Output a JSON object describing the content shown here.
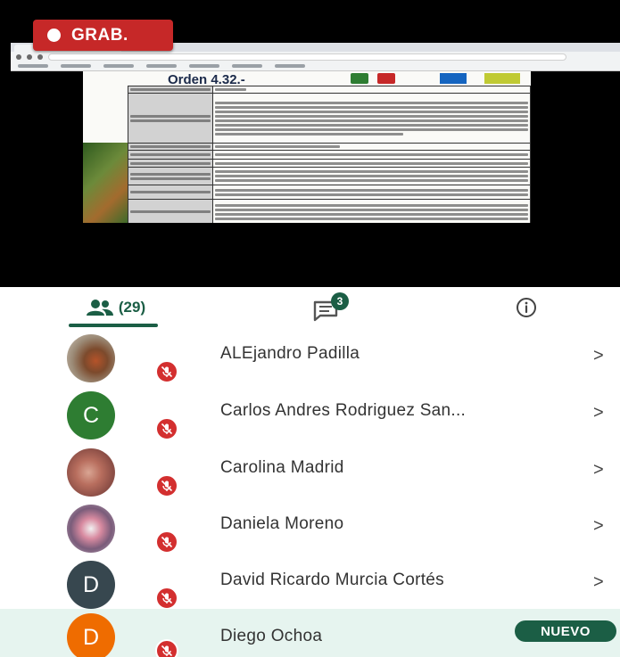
{
  "recording": {
    "label": "GRAB."
  },
  "document": {
    "title": "Orden 4.32.-"
  },
  "tabs": {
    "participants_count": "(29)",
    "chat_unread": "3"
  },
  "participants": [
    {
      "name": "ALEjandro Padilla",
      "initial": "",
      "avatar": "photo",
      "avatar_color": "",
      "muted": true,
      "badge": ""
    },
    {
      "name": "Carlos Andres Rodriguez San...",
      "initial": "C",
      "avatar": "initial",
      "avatar_color": "#2e7d32",
      "muted": true,
      "badge": ""
    },
    {
      "name": "Carolina Madrid",
      "initial": "",
      "avatar": "photo",
      "avatar_color": "",
      "muted": true,
      "badge": ""
    },
    {
      "name": "Daniela Moreno",
      "initial": "",
      "avatar": "photo",
      "avatar_color": "",
      "muted": true,
      "badge": ""
    },
    {
      "name": "David Ricardo Murcia Cortés",
      "initial": "D",
      "avatar": "initial",
      "avatar_color": "#37474f",
      "muted": true,
      "badge": ""
    },
    {
      "name": "Diego Ochoa",
      "initial": "D",
      "avatar": "initial",
      "avatar_color": "#ef6c00",
      "muted": true,
      "badge": "NUEVO"
    }
  ],
  "colors": {
    "accent": "#1b5e45",
    "record": "#c62828",
    "mute": "#d32f2f",
    "highlight_row": "#e6f4ef"
  },
  "icons": {
    "people_tab": "people-icon",
    "chat_tab": "chat-icon",
    "info_tab": "info-icon",
    "mute": "mic-off-icon",
    "row_action": "chevron-right-icon"
  }
}
